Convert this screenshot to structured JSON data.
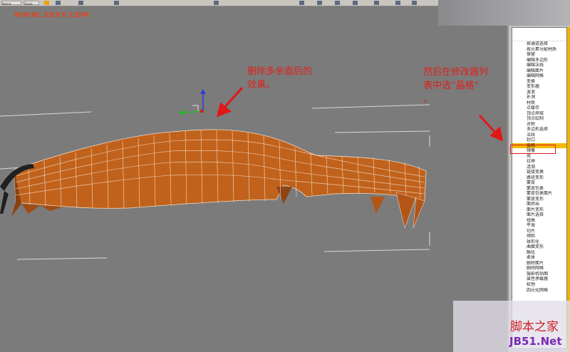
{
  "toolbar": {
    "field_1": "Select",
    "field_2": "Zoom"
  },
  "watermark_top": "WWW.3DXY.COM",
  "annotations": {
    "note_delete_line1": "删除多余面后的",
    "note_delete_line2": "效果。",
    "note_select_line1": "然后在修改器列",
    "note_select_line2": "表中选“晶格”",
    "note_select_line3": "。"
  },
  "modifier_list": {
    "items": [
      "按通道选择",
      "按元素分配材质",
      "保留",
      "编辑多边形",
      "编辑法线",
      "编辑面片",
      "编辑网格",
      "变换",
      "变形器",
      "波浪",
      "补洞",
      "材质",
      "点缓存",
      "顶点焊接",
      "顶点绘制",
      "对称",
      "多边形选择",
      "法线",
      "封口",
      "晶格",
      "镜像",
      "壳",
      "拉伸",
      "涟漪",
      "链接变换",
      "路径变形",
      "蒙皮",
      "蒙皮包裹",
      "蒙皮包裹面片",
      "蒙皮变形",
      "面挤出",
      "面片变形",
      "面片选择",
      "扭曲",
      "平滑",
      "切片",
      "倾斜",
      "球形化",
      "曲面变形",
      "融化",
      "柔体",
      "删除面片",
      "删除网格",
      "摄影机贴图",
      "属性承载器",
      "松弛"
    ],
    "selected_index": 19,
    "bottom_item": "四元化网格"
  },
  "site_watermark": {
    "line1": "脚本之家",
    "line2": "JB51.Net"
  },
  "colors": {
    "viewport_bg": "#7b7b7b",
    "mesh_fill": "#c0621c",
    "annotation": "#e0201a",
    "selection": "#f3b90a"
  }
}
